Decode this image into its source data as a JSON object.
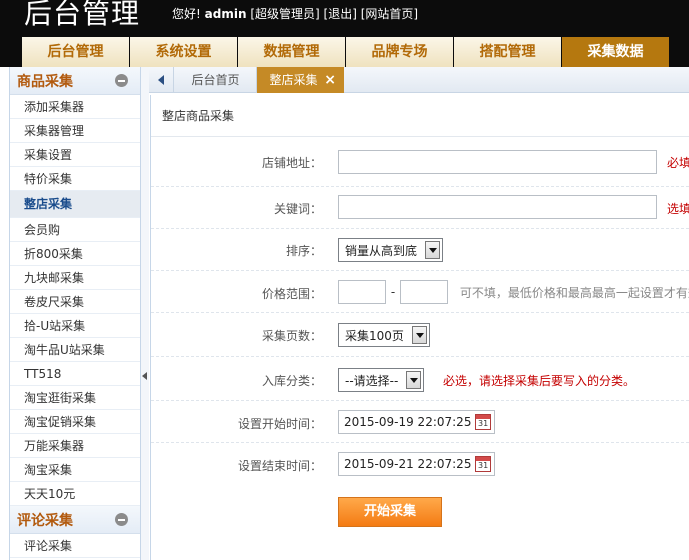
{
  "header": {
    "logo": "后台管理",
    "greeting": "您好!",
    "username": "admin",
    "role": "[超级管理员]",
    "logout": "[退出]",
    "site_home": "[网站首页]"
  },
  "nav": [
    {
      "label": "后台管理"
    },
    {
      "label": "系统设置"
    },
    {
      "label": "数据管理"
    },
    {
      "label": "品牌专场"
    },
    {
      "label": "搭配管理"
    },
    {
      "label": "采集数据",
      "active": true
    }
  ],
  "sidebar": {
    "group1": {
      "title": "商品采集",
      "items": [
        "添加采集器",
        "采集器管理",
        "采集设置",
        "特价采集",
        "整店采集",
        "会员购",
        "折800采集",
        "九块邮采集",
        "卷皮尺采集",
        "拾-U站采集",
        "淘牛品U站采集",
        "TT518",
        "淘宝逛街采集",
        "淘宝促销采集",
        "万能采集器",
        "淘宝采集",
        "天天10元"
      ]
    },
    "group2": {
      "title": "评论采集",
      "items": [
        "评论采集"
      ]
    }
  },
  "tabs": {
    "home": "后台首页",
    "current": "整店采集",
    "close": "×"
  },
  "form": {
    "title": "整店商品采集",
    "shop_url": {
      "label": "店铺地址：",
      "value": "",
      "hint": "必填"
    },
    "keyword": {
      "label": "关键词：",
      "value": "",
      "hint": "选填"
    },
    "sort": {
      "label": "排序：",
      "selected": "销量从高到底"
    },
    "price": {
      "label": "价格范围：",
      "min": "",
      "max": "",
      "separator": "-",
      "hint": "可不填，最低价格和最高最高一起设置才有效"
    },
    "pages": {
      "label": "采集页数：",
      "selected": "采集100页"
    },
    "category": {
      "label": "入库分类：",
      "selected": "--请选择--",
      "hint": "必选，请选择采集后要写入的分类。"
    },
    "start_time": {
      "label": "设置开始时间：",
      "value": "2015-09-19 22:07:25"
    },
    "end_time": {
      "label": "设置结束时间：",
      "value": "2015-09-21 22:07:25"
    },
    "submit": "开始采集"
  }
}
